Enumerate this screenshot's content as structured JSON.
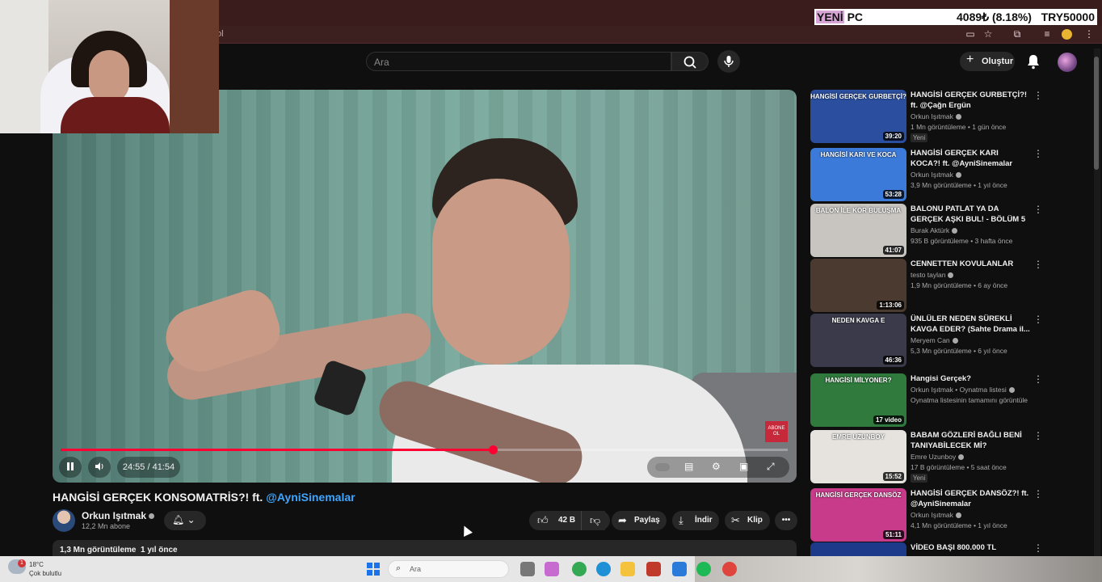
{
  "ticker": {
    "name_a": "YENİ",
    "name_b": " PC",
    "change": "4089₺ (8.18%)",
    "goal": "TRY50000"
  },
  "browser": {
    "url_fragment": "ol"
  },
  "header": {
    "search_placeholder": "Ara",
    "create_label": "Oluştur"
  },
  "player": {
    "time": "24:55 / 41:54",
    "progress": 0.594,
    "badge": "ABONE OL"
  },
  "video": {
    "title_main": "HANGİSİ GERÇEK KONSOMATRİS?! ft. ",
    "title_mention": "@AyniSinemalar",
    "channel": "Orkun Işıtmak",
    "subscribers": "12,2 Mn abone",
    "likes": "42 B",
    "share": "Paylaş",
    "download": "İndir",
    "clip": "Klip",
    "views": "1,3 Mn görüntüleme",
    "age": "1 yıl önce"
  },
  "recs": [
    {
      "title": "HANGİSİ GERÇEK GURBETÇİ?! ft. @Çağn Ergün",
      "channel": "Orkun Işıtmak",
      "meta": "1 Mn görüntüleme • 1 gün önce",
      "duration": "39:20",
      "thumb_text": "HANGİSİ GERÇEK GURBETÇİ?",
      "new": "Yeni",
      "color": "#2b4f9e"
    },
    {
      "title": "HANGİSİ GERÇEK KARI KOCA?! ft. @AyniSinemalar",
      "channel": "Orkun Işıtmak",
      "meta": "3,9 Mn görüntüleme • 1 yıl önce",
      "duration": "53:28",
      "thumb_text": "HANGİSİ KARI VE KOCA",
      "new": "",
      "color": "#3b7ad9"
    },
    {
      "title": "BALONU PATLAT YA DA GERÇEK AŞKI BUL! - BÖLÜM 5",
      "channel": "Burak Aktürk",
      "meta": "935 B görüntüleme • 3 hafta önce",
      "duration": "41:07",
      "thumb_text": "BALON İLE KÖR BULUŞMA",
      "new": "",
      "color": "#c8c4c0"
    },
    {
      "title": "CENNETTEN KOVULANLAR",
      "channel": "testo taylan",
      "meta": "1,9 Mn görüntüleme • 6 ay önce",
      "duration": "1:13:06",
      "thumb_text": "",
      "new": "",
      "color": "#4a3a30"
    },
    {
      "title": "ÜNLÜLER NEDEN SÜREKLİ KAVGA EDER? (Sahte Drama il...",
      "channel": "Meryem Can",
      "meta": "5,3 Mn görüntüleme • 6 yıl önce",
      "duration": "46:36",
      "thumb_text": "NEDEN KAVGA E",
      "new": "",
      "color": "#3a3a4a"
    },
    {
      "title": "Hangisi Gerçek?",
      "channel": "Orkun Işıtmak • Oynatma listesi",
      "meta": "Oynatma listesinin tamamını görüntüle",
      "duration": "17 video",
      "thumb_text": "HANGİSİ MİLYONER?",
      "new": "",
      "color": "#2f7a3c"
    },
    {
      "title": "BABAM GÖZLERİ BAĞLI BENİ TANIYABİLECEK Mİ?",
      "channel": "Emre Uzunboy",
      "meta": "17 B görüntüleme • 5 saat önce",
      "duration": "15:52",
      "thumb_text": "EMRE UZUNBOY",
      "new": "Yeni",
      "color": "#e6e3df"
    },
    {
      "title": "HANGİSİ GERÇEK DANSÖZ?! ft. @AyniSinemalar",
      "channel": "Orkun Işıtmak",
      "meta": "4,1 Mn görüntüleme • 1 yıl önce",
      "duration": "51:11",
      "thumb_text": "HANGİSİ GERÇEK DANSÖZ",
      "new": "",
      "color": "#c83a8a"
    },
    {
      "title": "VİDEO BAŞI 800.000 TL",
      "channel": "",
      "meta": "",
      "duration": "",
      "thumb_text": "",
      "new": "",
      "color": "#1d3a8a"
    }
  ],
  "taskbar": {
    "temp": "18°C",
    "weather": "Çok bulutlu",
    "notif": "1",
    "search": "Ara"
  }
}
